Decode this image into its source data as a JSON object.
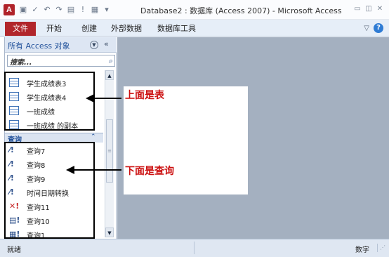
{
  "titlebar": {
    "app_icon": "A",
    "title": "Database2 : 数据库 (Access 2007) - Microsoft Access",
    "qat_icons": [
      "save-icon",
      "checkmark-icon",
      "undo-icon",
      "redo-icon",
      "view-icon",
      "run-icon",
      "table-icon",
      "customize-icon"
    ],
    "window_controls": [
      "minimize-icon",
      "restore-icon",
      "close-icon"
    ]
  },
  "ribbon": {
    "file_tab": "文件",
    "tabs": [
      "开始",
      "创建",
      "外部数据",
      "数据库工具"
    ],
    "help": "?"
  },
  "nav": {
    "title": "所有 Access 对象",
    "search_placeholder": "搜索...",
    "tables": [
      "学生成绩表3",
      "学生成绩表4",
      "一班成绩",
      "一班成绩 的副本"
    ],
    "queries_header": "查询",
    "queries": [
      "查询7",
      "查询8",
      "查询9",
      "时间日期转换",
      "查询11",
      "查询10",
      "查询1"
    ]
  },
  "annotations": {
    "tables_label": "上面是表",
    "queries_label": "下面是查询"
  },
  "status": {
    "left": "就绪",
    "right": "数字"
  },
  "colors": {
    "file_tab": "#b1262b",
    "nav_title": "#21519a",
    "annotation_text": "#cc1010",
    "workspace": "#a4b0c0"
  }
}
